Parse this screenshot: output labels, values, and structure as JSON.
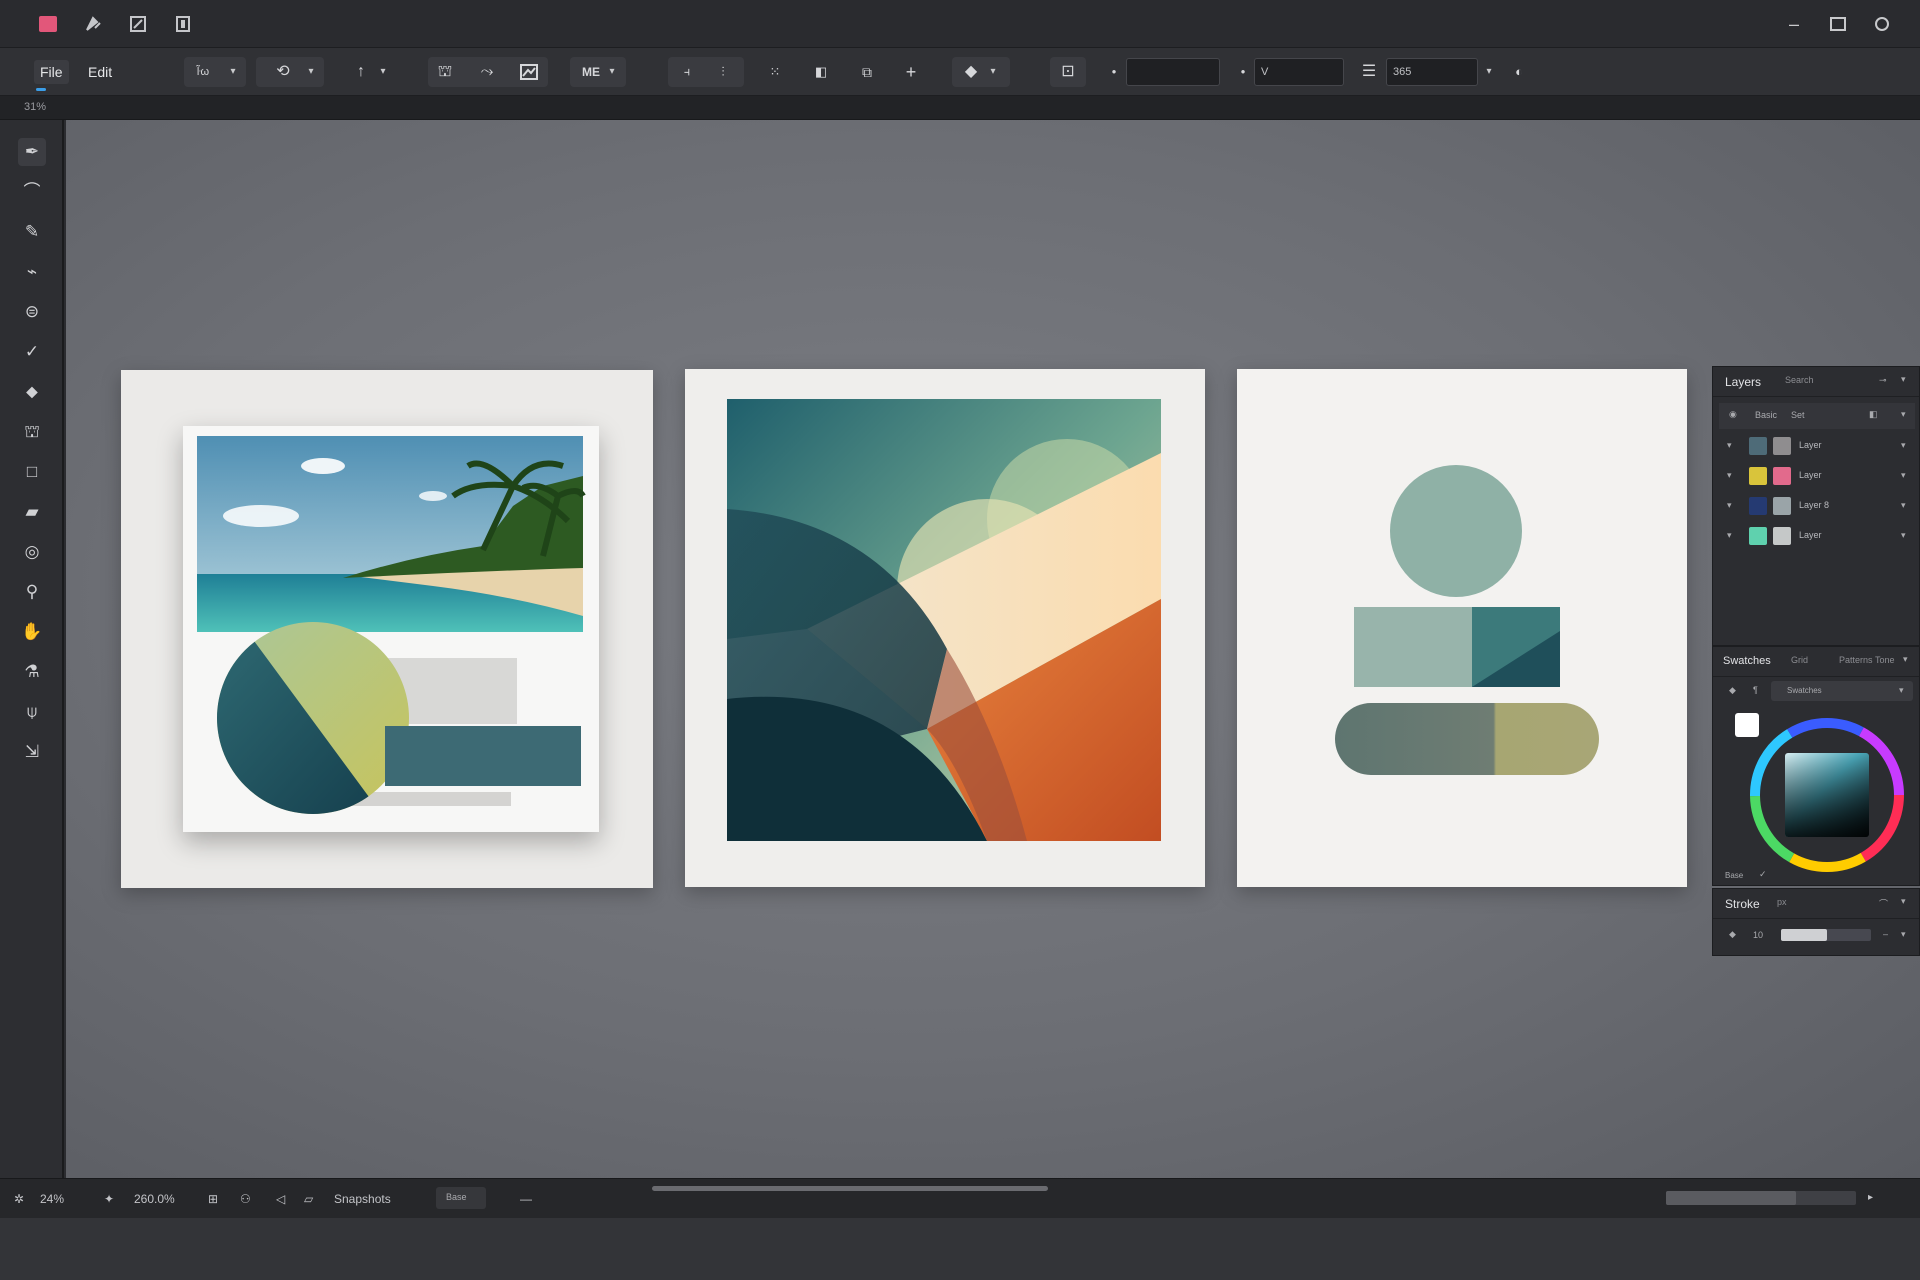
{
  "colors": {
    "chrome": "#2a2b2f",
    "toolbar": "#303135",
    "canvas": "#6f7177",
    "panel": "#2c2d31",
    "teal_dark": "#1f4b57",
    "teal_mid": "#3e6b74",
    "sage": "#8fb0a6",
    "olive": "#a9a674",
    "orange": "#de6a2d",
    "cream": "#f6dfbd"
  },
  "titlebar": {
    "icons": [
      "app-icon",
      "brush-tool-icon",
      "layers-icon",
      "panel-icon"
    ],
    "window_controls": [
      "minimize-icon",
      "restore-icon",
      "close-icon"
    ]
  },
  "menu": {
    "file": "File",
    "edit": "Edit"
  },
  "toolbar": {
    "field_small": "ŀ̃ω",
    "mode_label": "ME",
    "field_a": "",
    "field_b": "V",
    "field_c": "365"
  },
  "ruler": {
    "label": "31%"
  },
  "left_tools": [
    "pen-tool-icon",
    "smudge-tool-icon",
    "pencil-tool-icon",
    "brush-tool-icon",
    "blur-tool-icon",
    "check-tool-icon",
    "eraser-tool-icon",
    "stamp-tool-icon",
    "rectangle-tool-icon",
    "fill-tool-icon",
    "lasso-tool-icon",
    "zoom-tool-icon",
    "hand-tool-icon",
    "eyedropper-tool-icon",
    "pin-tool-icon",
    "move-tool-icon"
  ],
  "layers_panel": {
    "title": "Layers",
    "search": "Search",
    "header_row": "Basic",
    "header_row_b": "Set",
    "rows": [
      {
        "name": "Layer",
        "c1": "#4e6b78",
        "c2": "#8f8d8f"
      },
      {
        "name": "Layer",
        "c1": "#d9c43b",
        "c2": "#e26a8c"
      },
      {
        "name": "Layer 8",
        "c1": "#253a72",
        "c2": "#9aa4a8"
      },
      {
        "name": "Layer",
        "c1": "#5fd1ae",
        "c2": "#c5c8c8"
      }
    ]
  },
  "swatches_panel": {
    "title": "Swatches",
    "tab_b": "Grid",
    "tab_c": "Patterns",
    "tab_d": "Tone",
    "dropdown": "Swatches",
    "footer": "Base"
  },
  "stroke_panel": {
    "title": "Stroke",
    "sub": "px",
    "value": "10"
  },
  "statusbar": {
    "zoom": "24%",
    "rotate": "260.0%",
    "snapping": "Snapshots",
    "status_btn": "Base"
  }
}
